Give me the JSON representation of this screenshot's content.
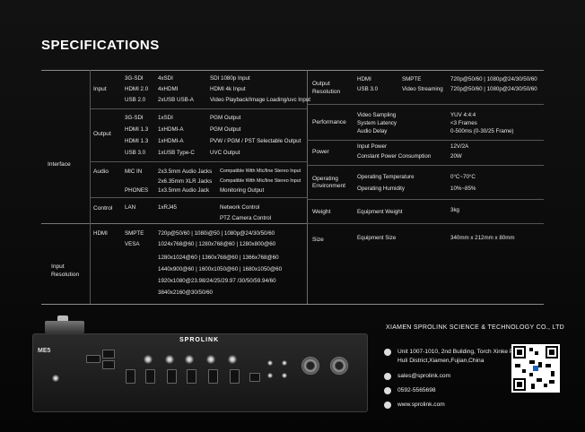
{
  "title": "SPECIFICATIONS",
  "interface": {
    "group_label": "Interface",
    "input": {
      "label": "Input",
      "rows": [
        {
          "c1": "3G-SDI",
          "c2": "4xSDI",
          "c3": "SDI 1080p Input"
        },
        {
          "c1": "HDMI  2.0",
          "c2": "4xHDMI",
          "c3": "HDMI 4k Input"
        },
        {
          "c1": "USB 2.0",
          "c2": "2xUSB  USB-A",
          "c3": "Video Playback/Image Loading/uvc Input"
        }
      ]
    },
    "output": {
      "label": "Output",
      "rows": [
        {
          "c1": "3G-SDI",
          "c2": "1xSDI",
          "c3": "PGM Output"
        },
        {
          "c1": "HDMI 1.3",
          "c2": "1xHDMI-A",
          "c3": "PGM Output"
        },
        {
          "c1": "HDMI 1.3",
          "c2": "1xHDMI-A",
          "c3": "PVW / PGM / PST Selectable Output"
        },
        {
          "c1": "USB 3.0",
          "c2": "1xUSB Type-C",
          "c3": "UVC Output"
        }
      ]
    },
    "audio": {
      "label": "Audio",
      "rows": [
        {
          "c1": "MIC IN",
          "c2": "2x3.5mm Audio Jacks",
          "c3": "Compatible With Mic/line Stereo Input"
        },
        {
          "c1": "",
          "c2": "2x6.35mm XLR Jacks",
          "c3": "Compatible With Mic/line Stereo Input"
        },
        {
          "c1": "PHONES",
          "c2": "1x3.5mm Audio Jack",
          "c3": "Monitoring Output"
        }
      ]
    },
    "control": {
      "label": "Control",
      "rows": [
        {
          "c1": "LAN",
          "c2": "1xRJ45",
          "c3": "Network Control"
        },
        {
          "c1": "",
          "c2": "",
          "c3": "PTZ Camera Control"
        }
      ]
    }
  },
  "input_resolution": {
    "label_line1": "Input",
    "label_line2": "Resolution",
    "hdmi_label": "HDMI",
    "smpte_label": "SMPTE",
    "vesa_label": "VESA",
    "smpte_value": "720p@50/60 | 1080i@50 | 1080p@24/30/50/60",
    "vesa_values": [
      "1024x768@60 | 1280x768@60 | 1280x800@60",
      "1280x1024@60 | 1360x768@60 | 1366x768@60",
      "1440x900@60 | 1600x1050@60 | 1680x1050@60",
      "1920x1080@23.98/24/25/29.97 /30/50/59.94/60",
      "3840x2160@30/50/60"
    ]
  },
  "right": {
    "output_resolution": {
      "label_line1": "Output",
      "label_line2": "Resolution",
      "col1": [
        "HDMI",
        "USB 3.0"
      ],
      "col2": [
        "SMPTE",
        "Video Streaming"
      ],
      "col3": [
        "720p@50/60 | 1080p@24/30/50/60",
        "720p@50/60 | 1080p@24/30/50/60"
      ]
    },
    "performance": {
      "label": "Performance",
      "keys": [
        "Video Sampling",
        "System Latency",
        "Audio Delay"
      ],
      "values": [
        "YUV 4:4:4",
        "<3 Frames",
        "0-500ms (0-30/25 Frame)"
      ]
    },
    "power": {
      "label": "Power",
      "keys": [
        "Input Power",
        "Constant Power Consumption"
      ],
      "values": [
        "12V/2A",
        "20W"
      ]
    },
    "environment": {
      "label_line1": "Operating",
      "label_line2": "Environment",
      "keys": [
        "Operating Temperature",
        "Operating Humidity"
      ],
      "values": [
        "0°C~70°C",
        "10%~85%"
      ]
    },
    "weight": {
      "label": "Weight",
      "key": "Equipment Weight",
      "value": "3kg"
    },
    "size": {
      "label": "Size",
      "key": "Equipment Size",
      "value": "340mm x 212mm x 80mm"
    }
  },
  "device": {
    "brand": "SPROLINK",
    "model": "ME5"
  },
  "company": {
    "name": "XIAMEN SPROLINK SCIENCE & TECHNOLOGY CO., LTD",
    "address_line1": "Unit 1007-1010, 2nd Building, Torch Xinke Plaza,",
    "address_line2": "Huli District,Xiamen,Fujian,China",
    "email": "sales@sprolink.com",
    "phone": "0592-5565698",
    "website": "www.sprolink.com"
  }
}
